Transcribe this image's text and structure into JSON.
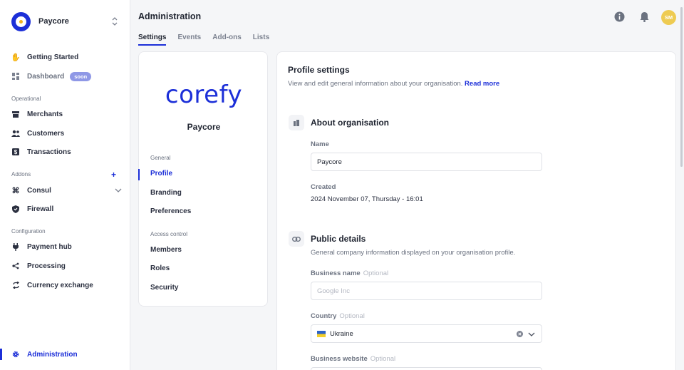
{
  "brand": {
    "name": "Paycore"
  },
  "sidebar": {
    "items": [
      {
        "label": "Getting Started",
        "icon": "wave-hand-icon"
      },
      {
        "label": "Dashboard",
        "icon": "dashboard-icon",
        "badge": "soon"
      },
      {
        "section": "Operational"
      },
      {
        "label": "Merchants",
        "icon": "store-icon"
      },
      {
        "label": "Customers",
        "icon": "users-icon"
      },
      {
        "label": "Transactions",
        "icon": "dollar-icon"
      },
      {
        "section": "Addons"
      },
      {
        "label": "Consul",
        "icon": "command-icon"
      },
      {
        "label": "Firewall",
        "icon": "shield-icon"
      },
      {
        "section": "Configuration"
      },
      {
        "label": "Payment hub",
        "icon": "plug-icon"
      },
      {
        "label": "Processing",
        "icon": "share-icon"
      },
      {
        "label": "Currency exchange",
        "icon": "exchange-icon"
      },
      {
        "label": "Administration",
        "icon": "gear-icon",
        "active": true
      }
    ],
    "addons_plus": "+"
  },
  "header": {
    "title": "Administration",
    "tabs": [
      {
        "label": "Settings",
        "active": true
      },
      {
        "label": "Events"
      },
      {
        "label": "Add-ons"
      },
      {
        "label": "Lists"
      }
    ],
    "avatar_initials": "SM"
  },
  "profile_card": {
    "logo_text": "corefy",
    "org_name": "Paycore",
    "sections": [
      {
        "title": "General",
        "items": [
          "Profile",
          "Branding",
          "Preferences"
        ]
      },
      {
        "title": "Access control",
        "items": [
          "Members",
          "Roles",
          "Security"
        ]
      }
    ],
    "active_item": "Profile"
  },
  "settings": {
    "title": "Profile settings",
    "description": "View and edit general information about your organisation.",
    "read_more": "Read more",
    "about": {
      "title": "About organisation",
      "name_label": "Name",
      "name_value": "Paycore",
      "created_label": "Created",
      "created_value": "2024 November 07, Thursday - 16:01"
    },
    "public": {
      "title": "Public details",
      "subtitle": "General company information displayed on your organisation profile.",
      "business_name_label": "Business name",
      "optional": "Optional",
      "business_name_placeholder": "Google Inc",
      "country_label": "Country",
      "country_value": "Ukraine",
      "website_label": "Business website"
    }
  },
  "colors": {
    "accent": "#1c2fd8",
    "avatar": "#eecb52",
    "badge": "#8f98e6"
  }
}
